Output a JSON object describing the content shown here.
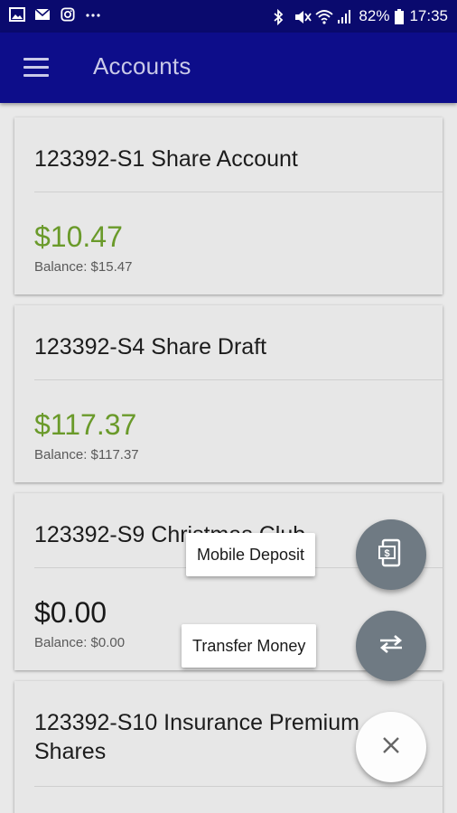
{
  "status_bar": {
    "battery_percent": "82%",
    "time": "17:35",
    "left_icons": [
      "image-icon",
      "mail-icon",
      "instagram-icon",
      "more-icon"
    ],
    "right_icons": [
      "bluetooth-icon",
      "mute-icon",
      "wifi-icon",
      "signal-icon",
      "battery-icon"
    ]
  },
  "app_bar": {
    "title": "Accounts",
    "menu_icon": "hamburger-menu-icon"
  },
  "accounts": [
    {
      "name": "123392-S1 Share Account",
      "available": "$10.47",
      "balance": "Balance: $15.47",
      "amount_color": "#6a9a2a"
    },
    {
      "name": "123392-S4 Share Draft",
      "available": "$117.37",
      "balance": "Balance: $117.37",
      "amount_color": "#6a9a2a"
    },
    {
      "name": "123392-S9 Christmas Club",
      "available": "$0.00",
      "balance": "Balance: $0.00",
      "amount_color": "#1a1a1a"
    },
    {
      "name": "123392-S10 Insurance Premium Shares",
      "available": "",
      "balance": ""
    }
  ],
  "fab_menu": {
    "mobile_deposit_label": "Mobile Deposit",
    "mobile_deposit_icon": "mobile-deposit-icon",
    "transfer_label": "Transfer Money",
    "transfer_icon": "transfer-arrows-icon",
    "close_icon": "close-icon"
  },
  "colors": {
    "status_bar": "#0a0a6e",
    "app_bar": "#0d0d8a",
    "positive_amount": "#6a9a2a",
    "fab_grey": "#6f7a83"
  }
}
